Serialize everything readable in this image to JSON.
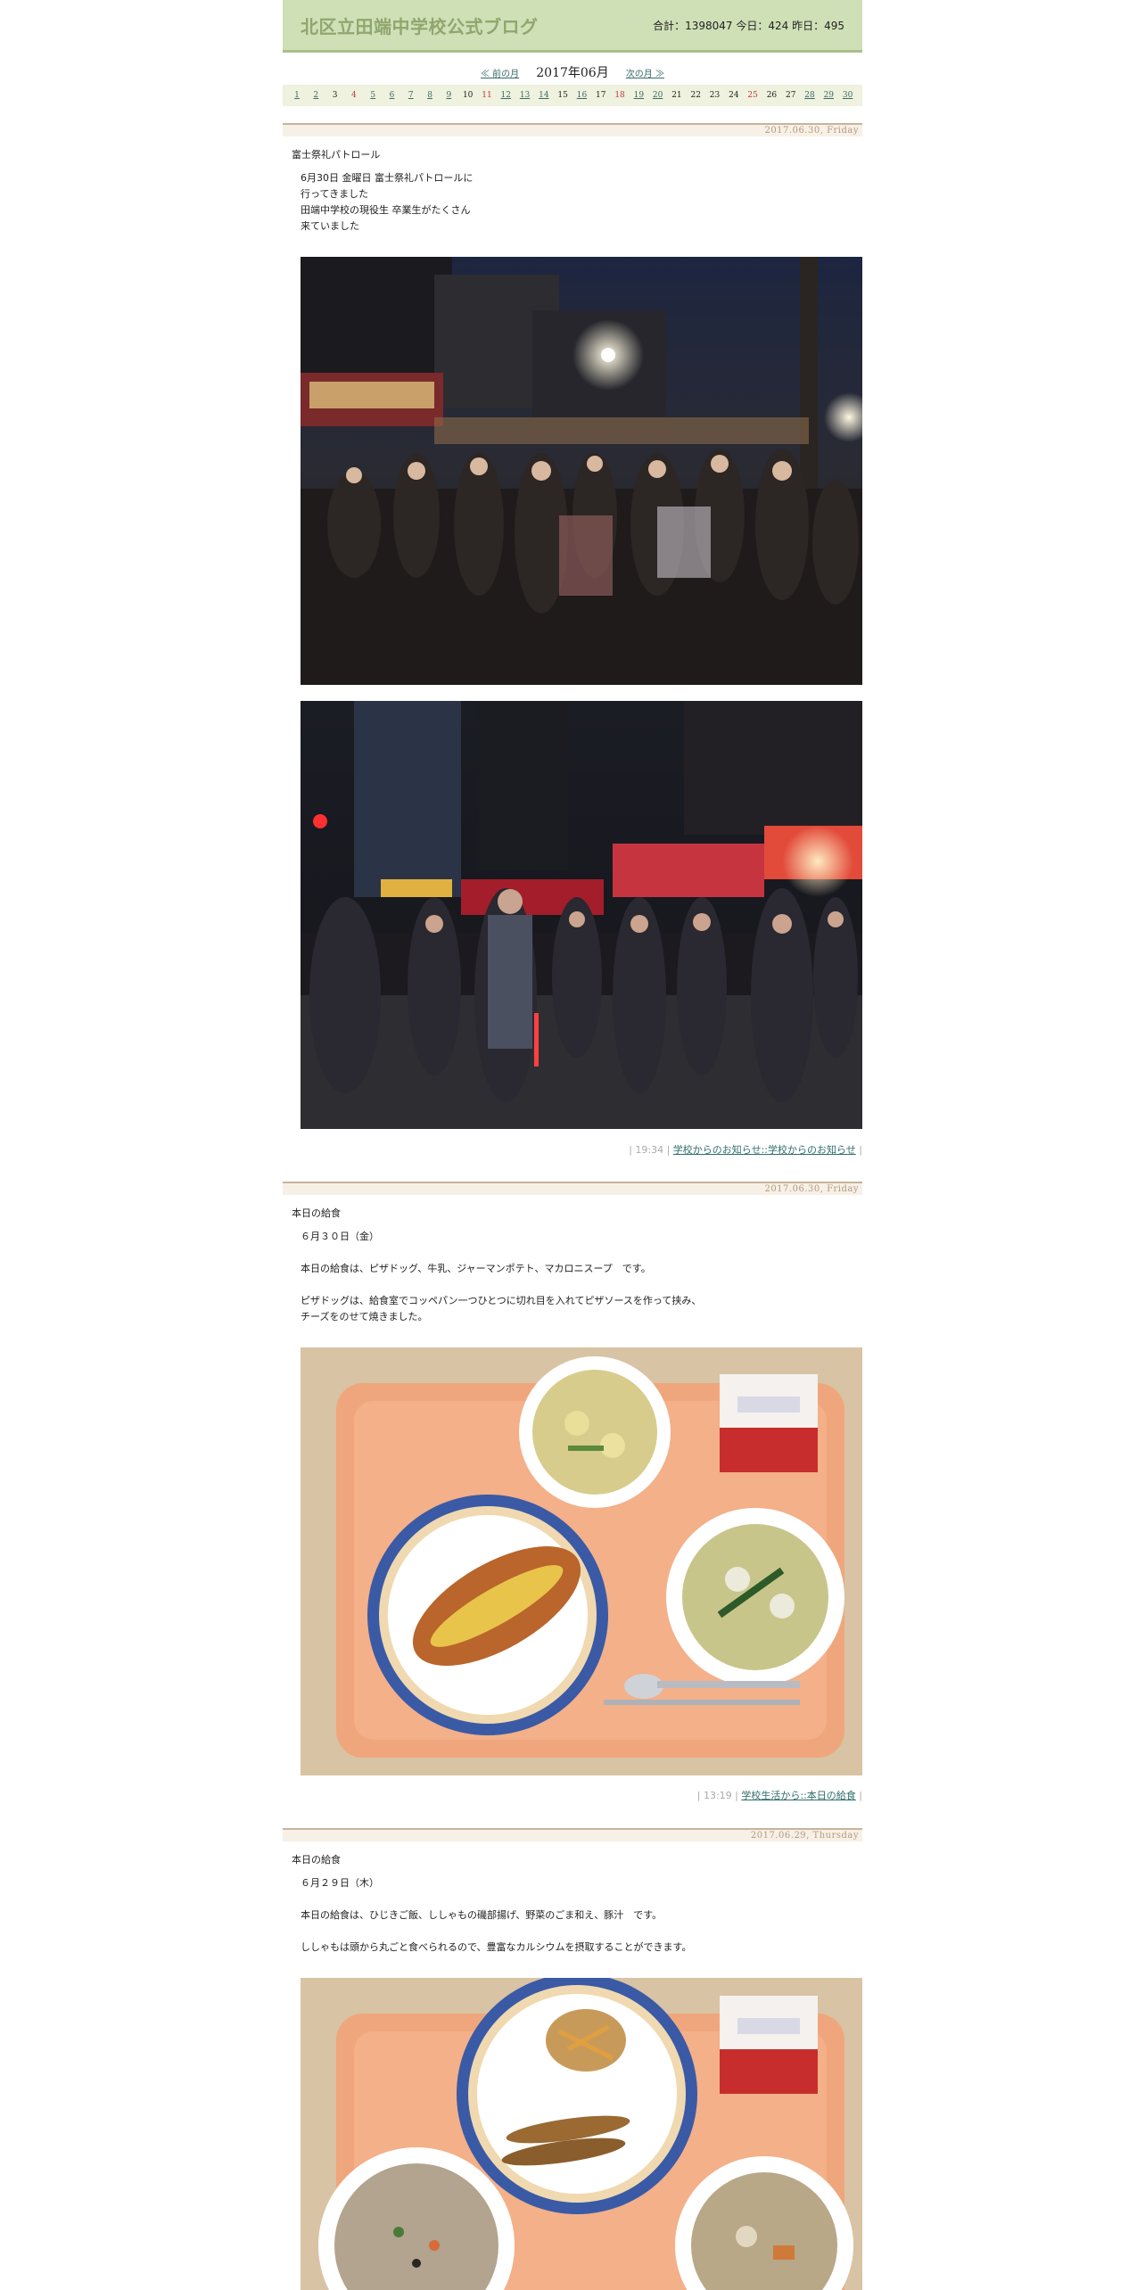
{
  "header": {
    "site_title": "北区立田端中学校公式ブログ",
    "counter": "合計：1398047 今日：424 昨日：495"
  },
  "month_nav": {
    "prev": "≪ 前の月",
    "current": "2017年06月",
    "next": "次の月 ≫"
  },
  "calendar": {
    "days": [
      {
        "d": "1",
        "type": "link"
      },
      {
        "d": "2",
        "type": "link"
      },
      {
        "d": "3",
        "type": "plain"
      },
      {
        "d": "4",
        "type": "sun"
      },
      {
        "d": "5",
        "type": "link"
      },
      {
        "d": "6",
        "type": "link"
      },
      {
        "d": "7",
        "type": "link"
      },
      {
        "d": "8",
        "type": "link"
      },
      {
        "d": "9",
        "type": "link"
      },
      {
        "d": "10",
        "type": "plain"
      },
      {
        "d": "11",
        "type": "sun"
      },
      {
        "d": "12",
        "type": "link"
      },
      {
        "d": "13",
        "type": "link"
      },
      {
        "d": "14",
        "type": "link"
      },
      {
        "d": "15",
        "type": "plain"
      },
      {
        "d": "16",
        "type": "link"
      },
      {
        "d": "17",
        "type": "plain"
      },
      {
        "d": "18",
        "type": "sun"
      },
      {
        "d": "19",
        "type": "link"
      },
      {
        "d": "20",
        "type": "link"
      },
      {
        "d": "21",
        "type": "plain"
      },
      {
        "d": "22",
        "type": "plain"
      },
      {
        "d": "23",
        "type": "plain"
      },
      {
        "d": "24",
        "type": "plain"
      },
      {
        "d": "25",
        "type": "sun"
      },
      {
        "d": "26",
        "type": "plain"
      },
      {
        "d": "27",
        "type": "plain"
      },
      {
        "d": "28",
        "type": "link"
      },
      {
        "d": "29",
        "type": "link"
      },
      {
        "d": "30",
        "type": "link"
      }
    ]
  },
  "posts": [
    {
      "date": "2017.06.30, Friday",
      "title": "富士祭礼パトロール",
      "lines": [
        "6月30日 金曜日 富士祭礼パトロールに",
        "行ってきました",
        "田端中学校の現役生 卒業生がたくさん",
        "来ていました"
      ],
      "meta_time": "| 19:34 |",
      "meta_link": "学校からのお知らせ::学校からのお知らせ",
      "meta_end": "|"
    },
    {
      "date": "2017.06.30, Friday",
      "title": "本日の給食",
      "lines": [
        "６月３０日（金）",
        "",
        "本日の給食は、ピザドッグ、牛乳、ジャーマンポテト、マカロニスープ　です。",
        "",
        "ピザドッグは、給食室でコッペパン一つひとつに切れ目を入れてピザソースを作って挟み、",
        "チーズをのせて焼きました。"
      ],
      "meta_time": "| 13:19 |",
      "meta_link": "学校生活から::本日の給食",
      "meta_end": "|"
    },
    {
      "date": "2017.06.29, Thursday",
      "title": "本日の給食",
      "lines": [
        "６月２９日（木）",
        "",
        "本日の給食は、ひじきご飯、ししゃもの磯部揚げ、野菜のごま和え、豚汁　です。",
        "",
        "ししゃもは頭から丸ごと食べられるので、豊富なカルシウムを摂取することができます。"
      ]
    }
  ],
  "colors": {
    "header_bg": "#cfe0b6",
    "title": "#8fa66f",
    "link": "#2f6d6d",
    "sunday": "#c23b3b",
    "date_bar": "#f7f0e6"
  }
}
